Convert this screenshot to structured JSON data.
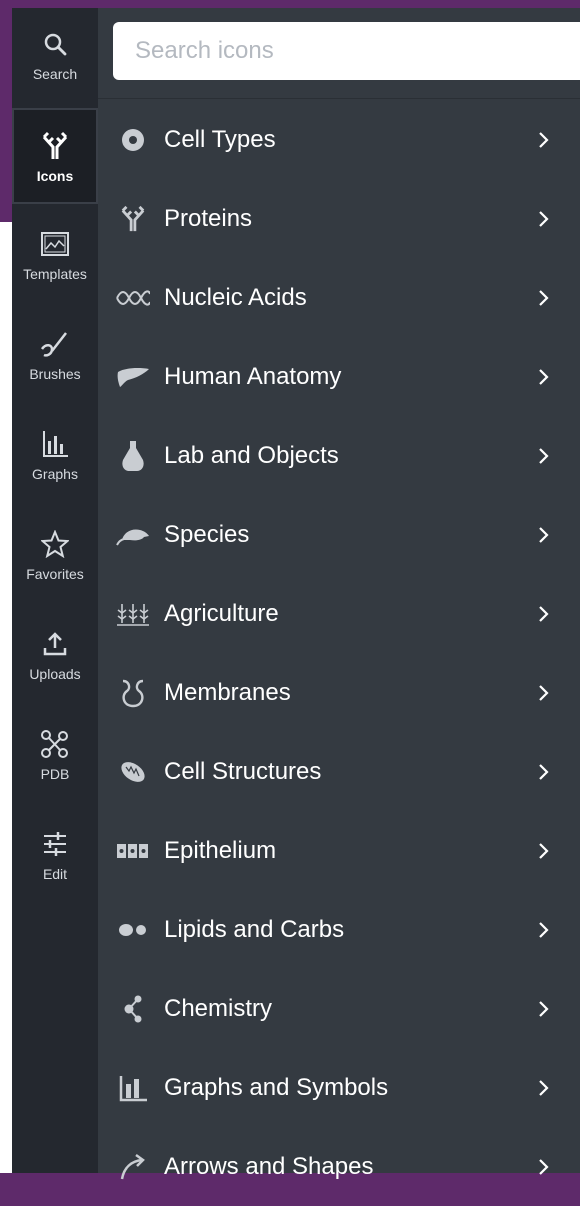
{
  "rail": {
    "items": [
      {
        "label": "Search",
        "icon": "search-icon"
      },
      {
        "label": "Icons",
        "icon": "antibody-icon",
        "active": true
      },
      {
        "label": "Templates",
        "icon": "image-icon"
      },
      {
        "label": "Brushes",
        "icon": "brush-icon"
      },
      {
        "label": "Graphs",
        "icon": "bar-chart-icon"
      },
      {
        "label": "Favorites",
        "icon": "star-icon"
      },
      {
        "label": "Uploads",
        "icon": "upload-icon"
      },
      {
        "label": "PDB",
        "icon": "molecule-icon"
      },
      {
        "label": "Edit",
        "icon": "sliders-icon"
      }
    ]
  },
  "search": {
    "placeholder": "Search icons",
    "value": ""
  },
  "categories": [
    {
      "label": "Cell Types",
      "icon": "cell-icon"
    },
    {
      "label": "Proteins",
      "icon": "antibody-icon"
    },
    {
      "label": "Nucleic Acids",
      "icon": "dna-icon"
    },
    {
      "label": "Human Anatomy",
      "icon": "liver-icon"
    },
    {
      "label": "Lab and Objects",
      "icon": "flask-icon"
    },
    {
      "label": "Species",
      "icon": "mouse-icon"
    },
    {
      "label": "Agriculture",
      "icon": "crops-icon"
    },
    {
      "label": "Membranes",
      "icon": "membrane-icon"
    },
    {
      "label": "Cell Structures",
      "icon": "mitochondria-icon"
    },
    {
      "label": "Epithelium",
      "icon": "epithelium-icon"
    },
    {
      "label": "Lipids and Carbs",
      "icon": "lipid-icon"
    },
    {
      "label": "Chemistry",
      "icon": "chemistry-icon"
    },
    {
      "label": "Graphs and Symbols",
      "icon": "graph-icon"
    },
    {
      "label": "Arrows and Shapes",
      "icon": "arrow-icon"
    }
  ],
  "colors": {
    "rail_bg": "#24282f",
    "panel_bg": "#343a41",
    "accent_purple": "#5e2a6a",
    "text": "#ffffff",
    "icon_gray": "#c9cdd2"
  }
}
